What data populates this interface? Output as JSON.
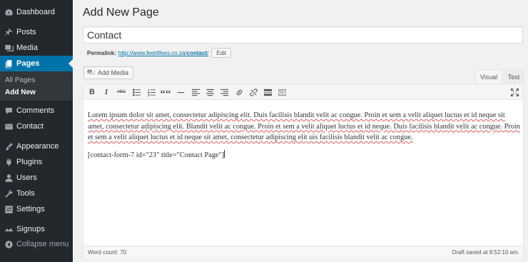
{
  "sidebar": {
    "items": [
      {
        "label": "Dashboard",
        "icon": "dashboard-icon"
      },
      {
        "label": "Posts",
        "icon": "pin-icon"
      },
      {
        "label": "Media",
        "icon": "media-icon"
      },
      {
        "label": "Pages",
        "icon": "pages-icon"
      },
      {
        "label": "Comments",
        "icon": "comment-icon"
      },
      {
        "label": "Contact",
        "icon": "mail-icon"
      },
      {
        "label": "Appearance",
        "icon": "brush-icon"
      },
      {
        "label": "Plugins",
        "icon": "plug-icon"
      },
      {
        "label": "Users",
        "icon": "user-icon"
      },
      {
        "label": "Tools",
        "icon": "wrench-icon"
      },
      {
        "label": "Settings",
        "icon": "settings-icon"
      },
      {
        "label": "Signups",
        "icon": "signup-icon"
      }
    ],
    "submenu": [
      "All Pages",
      "Add New"
    ],
    "collapse_label": "Collapse menu"
  },
  "page": {
    "title": "Add New Page",
    "title_value": "Contact",
    "permalink_label": "Permalink:",
    "permalink_base": "http://www.feet4fees.co.za/",
    "permalink_slug": "contact",
    "permalink_end": "/",
    "edit_label": "Edit"
  },
  "editor": {
    "add_media_label": "Add Media",
    "tab_visual": "Visual",
    "tab_text": "Text",
    "toolbar": {
      "bold": "B",
      "italic": "I",
      "strike": "ABC",
      "quote": "““"
    },
    "body_text": "Lorem ipsum dolor sit amet, consectetur adipiscing elit. Duis facilisis blandit velit ac congue. Proin et sem a velit aliquet luctus et id neque sit amet, consectetur adipiscing elit. Blandit velit ac congue. Proin et sem a velit aliquet luctus et id neque. Duis facilisis blandit velit ac congue. Proin et sem a velit aliquet luctus et id neque sit amet, consectetur adipiscing elit uis facilisis blandit velit ac congue.",
    "shortcode": "[contact-form-7 id=\"23\" title=\"Contact Page\"]",
    "word_count": "Word count: 70",
    "draft_status": "Draft saved at 8:52:10 am."
  },
  "colors": {
    "sidebar_bg": "#23282d",
    "accent": "#0073aa"
  }
}
